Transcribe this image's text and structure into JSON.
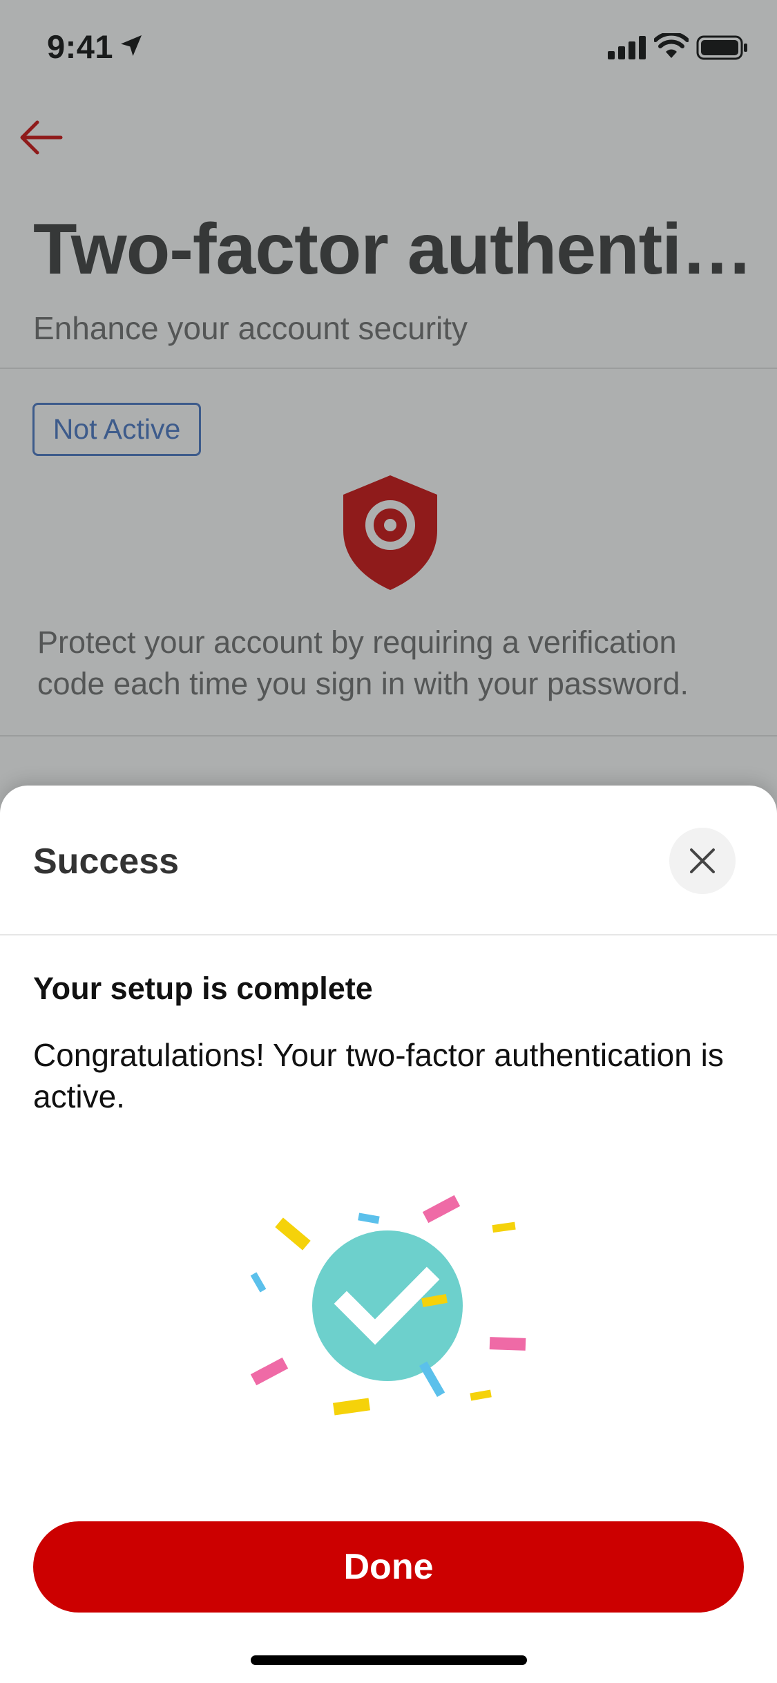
{
  "status_bar": {
    "time": "9:41"
  },
  "header": {
    "title": "Two-factor authenti…",
    "subtitle": "Enhance your account security"
  },
  "status": {
    "label": "Not Active"
  },
  "description": "Protect your account by requiring a verification code each time you sign in with your password.",
  "sheet": {
    "title": "Success",
    "heading": "Your setup is complete",
    "body": "Congratulations! Your two-factor authentication is active.",
    "done_label": "Done"
  },
  "colors": {
    "brand_red": "#cc0000",
    "badge_blue": "#3e6ec2",
    "check_teal": "#6dd0cc",
    "confetti_pink": "#ef6aa6",
    "confetti_yellow": "#f5d20a",
    "confetti_blue": "#5bc0eb"
  },
  "icons": [
    "location-arrow-icon",
    "signal-icon",
    "wifi-icon",
    "battery-icon",
    "back-arrow-icon",
    "shield-target-icon",
    "close-icon",
    "success-check-icon"
  ]
}
